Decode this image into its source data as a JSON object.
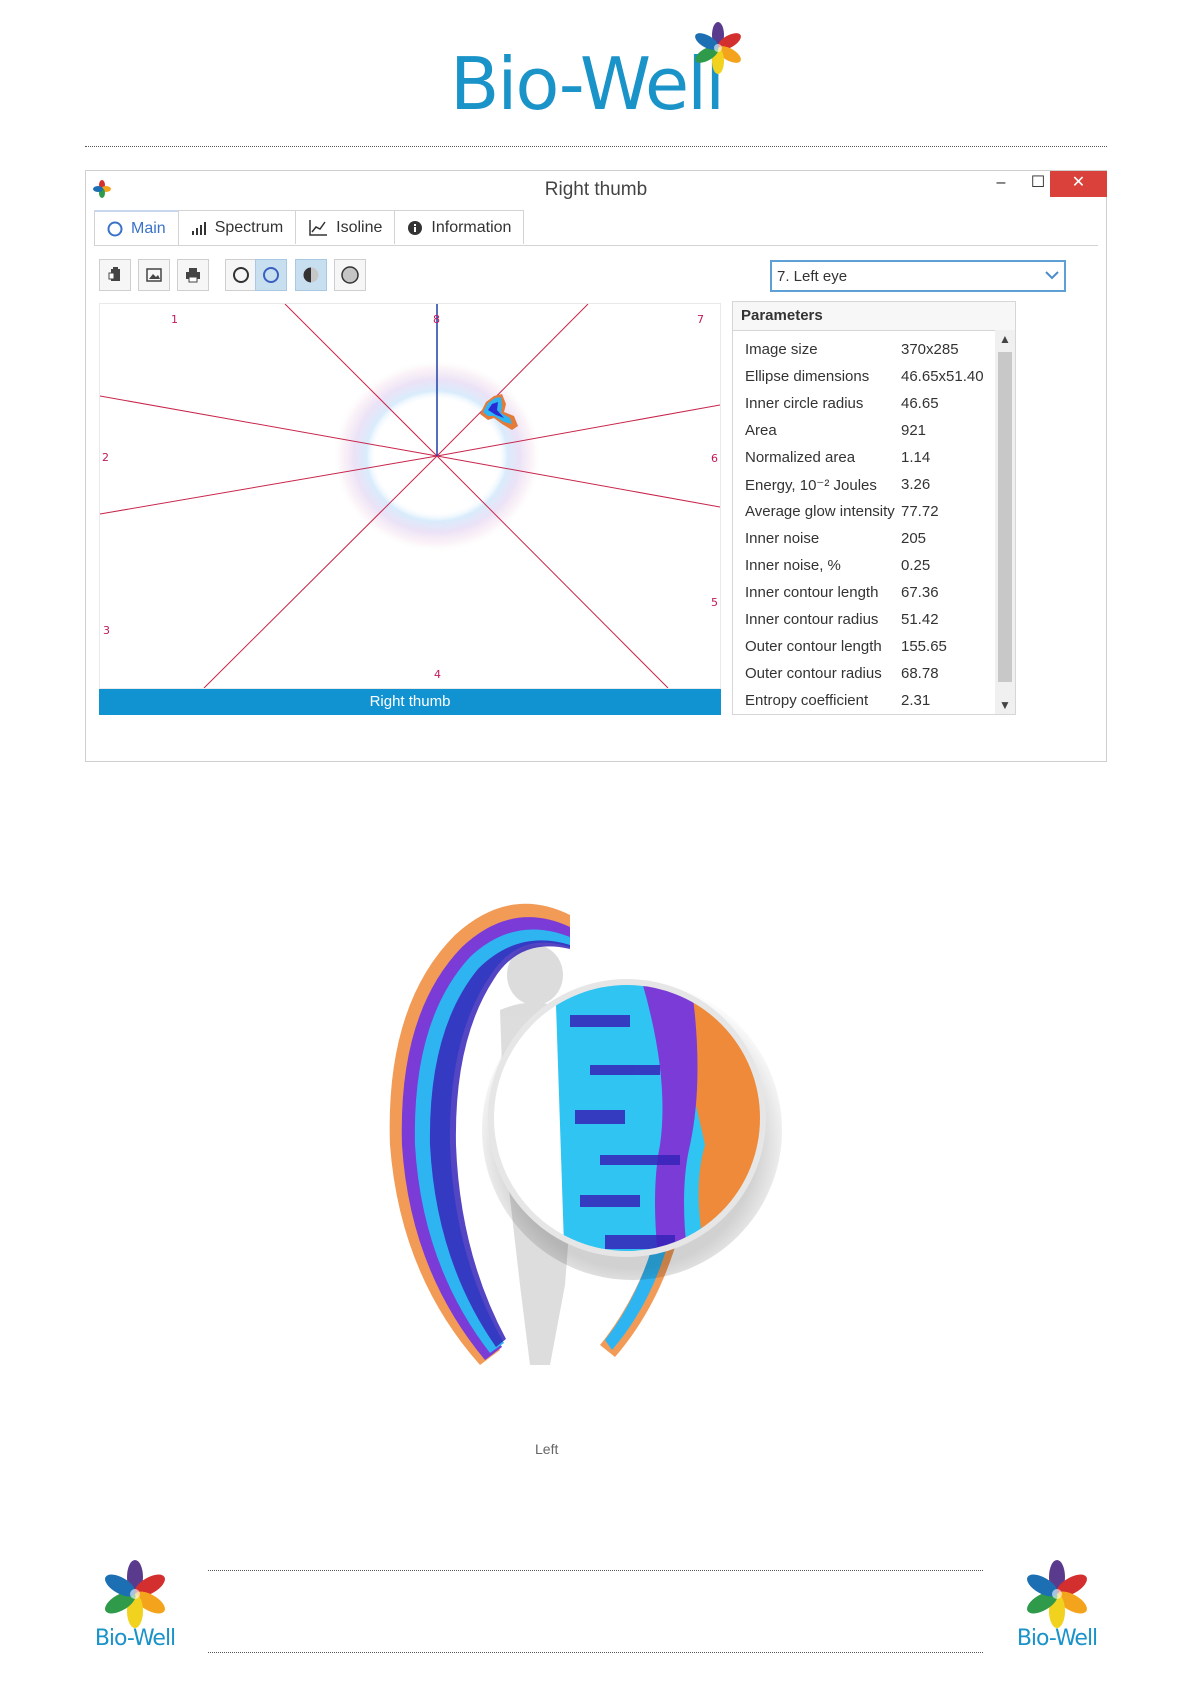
{
  "brand": {
    "name": "Bio-Well"
  },
  "window": {
    "title": "Right thumb",
    "controls": {
      "minimize": "–",
      "maximize": "☐",
      "close": "✕"
    }
  },
  "tabs": [
    {
      "label": "Main",
      "icon": "circle-icon",
      "active": true
    },
    {
      "label": "Spectrum",
      "icon": "bar-chart-icon",
      "active": false
    },
    {
      "label": "Isoline",
      "icon": "line-chart-icon",
      "active": false
    },
    {
      "label": "Information",
      "icon": "info-icon",
      "active": false
    }
  ],
  "toolbar": {
    "buttons": [
      "copy-icon",
      "image-icon",
      "print-icon",
      "circle-outline-icon",
      "circle-blue-icon",
      "half-circle-icon",
      "filled-circle-icon"
    ]
  },
  "sector_select": {
    "value": "7. Left eye"
  },
  "canvas": {
    "sector_labels": [
      "1",
      "2",
      "3",
      "4",
      "5",
      "6",
      "7",
      "8"
    ],
    "caption": "Right thumb"
  },
  "parameters": {
    "heading": "Parameters",
    "rows": [
      {
        "key": "Image size",
        "value": "370x285"
      },
      {
        "key": "Ellipse dimensions",
        "value": "46.65x51.40"
      },
      {
        "key": "Inner circle radius",
        "value": "46.65"
      },
      {
        "key": "Area",
        "value": "921"
      },
      {
        "key": "Normalized area",
        "value": "1.14"
      },
      {
        "key": "Energy, 10⁻² Joules",
        "value": "3.26"
      },
      {
        "key": "Average glow intensity",
        "value": "77.72"
      },
      {
        "key": "Inner noise",
        "value": "205"
      },
      {
        "key": "Inner noise, %",
        "value": "0.25"
      },
      {
        "key": "Inner contour length",
        "value": "67.36"
      },
      {
        "key": "Inner contour radius",
        "value": "51.42"
      },
      {
        "key": "Outer contour length",
        "value": "155.65"
      },
      {
        "key": "Outer contour radius",
        "value": "68.78"
      },
      {
        "key": "Entropy coefficient",
        "value": "2.31"
      }
    ]
  },
  "aura": {
    "caption": "Left"
  },
  "footer": {
    "left_logo": "Bio-Well",
    "right_logo": "Bio-Well"
  }
}
